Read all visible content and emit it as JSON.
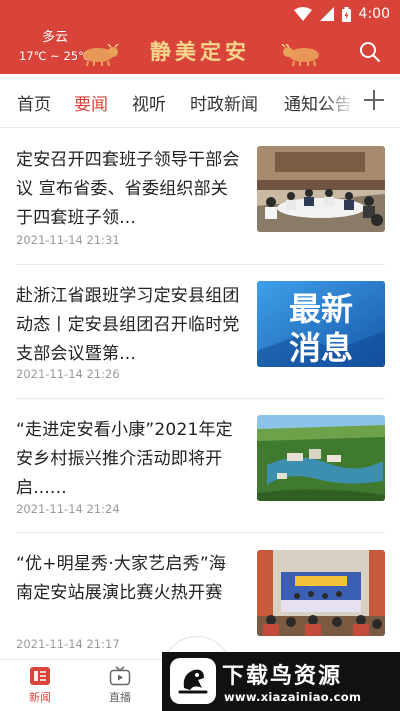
{
  "status_bar": {
    "time": "4:00"
  },
  "header": {
    "weather_desc": "多云",
    "temperature": "17℃ ~ 25℃",
    "brand": "静美定安",
    "search_icon": "search-icon"
  },
  "tabs": [
    {
      "label": "首页",
      "active": false
    },
    {
      "label": "要闻",
      "active": true
    },
    {
      "label": "视听",
      "active": false
    },
    {
      "label": "时政新闻",
      "active": false
    },
    {
      "label": "通知公告",
      "active": false
    }
  ],
  "news": [
    {
      "title": "定安召开四套班子领导干部会议 宣布省委、省委组织部关于四套班子领...",
      "date": "2021-11-14 21:31",
      "thumb": "meeting-photo"
    },
    {
      "title": "赴浙江省跟班学习定安县组团动态丨定安县组团召开临时党支部会议暨第...",
      "date": "2021-11-14 21:26",
      "thumb": "latest-news-graphic",
      "thumb_text": "最新消息"
    },
    {
      "title": "“走进定安看小康”2021年定安乡村振兴推介活动即将开启......",
      "date": "2021-11-14 21:24",
      "thumb": "aerial-village-photo"
    },
    {
      "title": "“优+明星秀·大家艺启秀”海南定安站展演比赛火热开赛",
      "date": "2021-11-14 21:17",
      "thumb": "stage-performance-photo"
    }
  ],
  "bottom_nav": [
    {
      "label": "新闻",
      "icon": "news-icon",
      "active": true
    },
    {
      "label": "直播",
      "icon": "tv-icon",
      "active": false
    }
  ],
  "watermark": {
    "title": "下载鸟资源",
    "url": "www.xiazainiao.com"
  },
  "colors": {
    "accent": "#d9443a",
    "brand_text": "#f6d68c",
    "date_text": "#999999"
  }
}
